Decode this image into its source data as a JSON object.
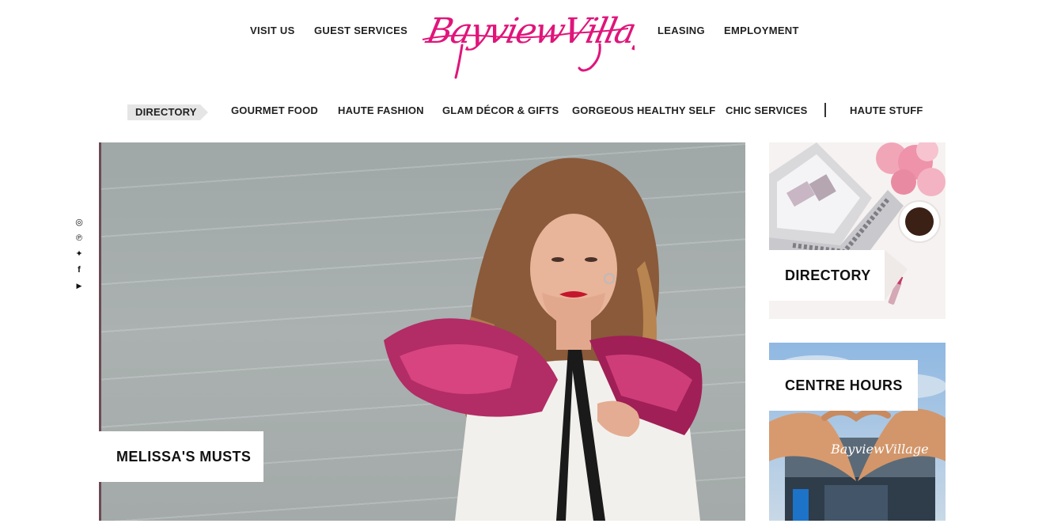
{
  "header": {
    "logo_text": "BayviewVillage",
    "nav_left": [
      "VISIT US",
      "GUEST SERVICES"
    ],
    "nav_right": [
      "LEASING",
      "EMPLOYMENT"
    ]
  },
  "categories": {
    "active": "DIRECTORY",
    "items": [
      "GOURMET FOOD",
      "HAUTE FASHION",
      "GLAM DÉCOR & GIFTS",
      "GORGEOUS HEALTHY SELF",
      "CHIC SERVICES"
    ],
    "extra": "HAUTE STUFF"
  },
  "social": [
    {
      "icon": "instagram-icon",
      "glyph": "◎"
    },
    {
      "icon": "pinterest-icon",
      "glyph": "℗"
    },
    {
      "icon": "twitter-icon",
      "glyph": "✦"
    },
    {
      "icon": "facebook-icon",
      "glyph": "f"
    },
    {
      "icon": "youtube-icon",
      "glyph": "▶"
    }
  ],
  "hero": {
    "label": "MELISSA'S MUSTS"
  },
  "tiles": [
    {
      "label": "DIRECTORY"
    },
    {
      "label": "CENTRE HOURS",
      "sign_text": "BayviewVillage"
    }
  ],
  "colors": {
    "brand_pink": "#e0157a",
    "active_tab_bg": "#e5e5e5"
  }
}
